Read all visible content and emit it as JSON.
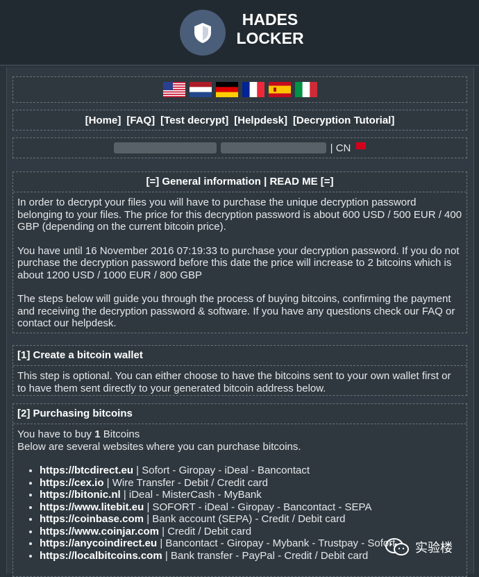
{
  "brand": {
    "line1": "HADES",
    "line2": "LOCKER"
  },
  "flags": [
    "us-flag-icon",
    "nl-flag-icon",
    "de-flag-icon",
    "fr-flag-icon",
    "es-flag-icon",
    "it-flag-icon"
  ],
  "nav": [
    "[Home]",
    "[FAQ]",
    "[Test decrypt]",
    "[Helpdesk]",
    "[Decryption Tutorial]"
  ],
  "ip": {
    "country": "| CN"
  },
  "general": {
    "title": "[=] General information | READ ME [=]",
    "p1": "In order to decrypt your files you will have to purchase the unique decryption password belonging to your files. The price for this decryption password is about 600 USD / 500 EUR / 400 GBP (depending on the current bitcoin price).",
    "p2": "You have until 16 November 2016 07:19:33 to purchase your decryption password. If you do not purchase the decryption password before this date the price will increase to 2 bitcoins which is about 1200 USD / 1000 EUR / 800 GBP",
    "p3": "The steps below will guide you through the process of buying bitcoins, confirming the payment and receiving the decryption password & software. If you have any questions check our FAQ or contact our helpdesk."
  },
  "step1": {
    "title": "[1] Create a bitcoin wallet",
    "text": "This step is optional. You can either choose to have the bitcoins sent to your own wallet first or to have them sent directly to your generated bitcoin address below."
  },
  "step2": {
    "title": "[2] Purchasing bitcoins",
    "buy_prefix": "You have to buy ",
    "buy_amount": "1",
    "buy_suffix": " Bitcoins",
    "line2": "Below are several websites where you can purchase bitcoins.",
    "sites": [
      {
        "url": "https://btcdirect.eu",
        "methods": " | Sofort - Giropay - iDeal - Bancontact"
      },
      {
        "url": "https://cex.io",
        "methods": " | Wire Transfer - Debit / Credit card"
      },
      {
        "url": "https://bitonic.nl",
        "methods": " | iDeal - MisterCash - MyBank"
      },
      {
        "url": "https://www.litebit.eu",
        "methods": " | SOFORT - iDeal - Giropay - Bancontact - SEPA"
      },
      {
        "url": "https://coinbase.com",
        "methods": " | Bank account (SEPA) - Credit / Debit card"
      },
      {
        "url": "https://www.coinjar.com",
        "methods": " | Credit / Debit card"
      },
      {
        "url": "https://anycoindirect.eu",
        "methods": " | Bancontact - Giropay - Mybank - Trustpay - Sofort"
      },
      {
        "url": "https://localbitcoins.com",
        "methods": " | Bank transfer - PayPal - Credit / Debit card"
      }
    ]
  },
  "watermark": {
    "text": "实验楼"
  }
}
